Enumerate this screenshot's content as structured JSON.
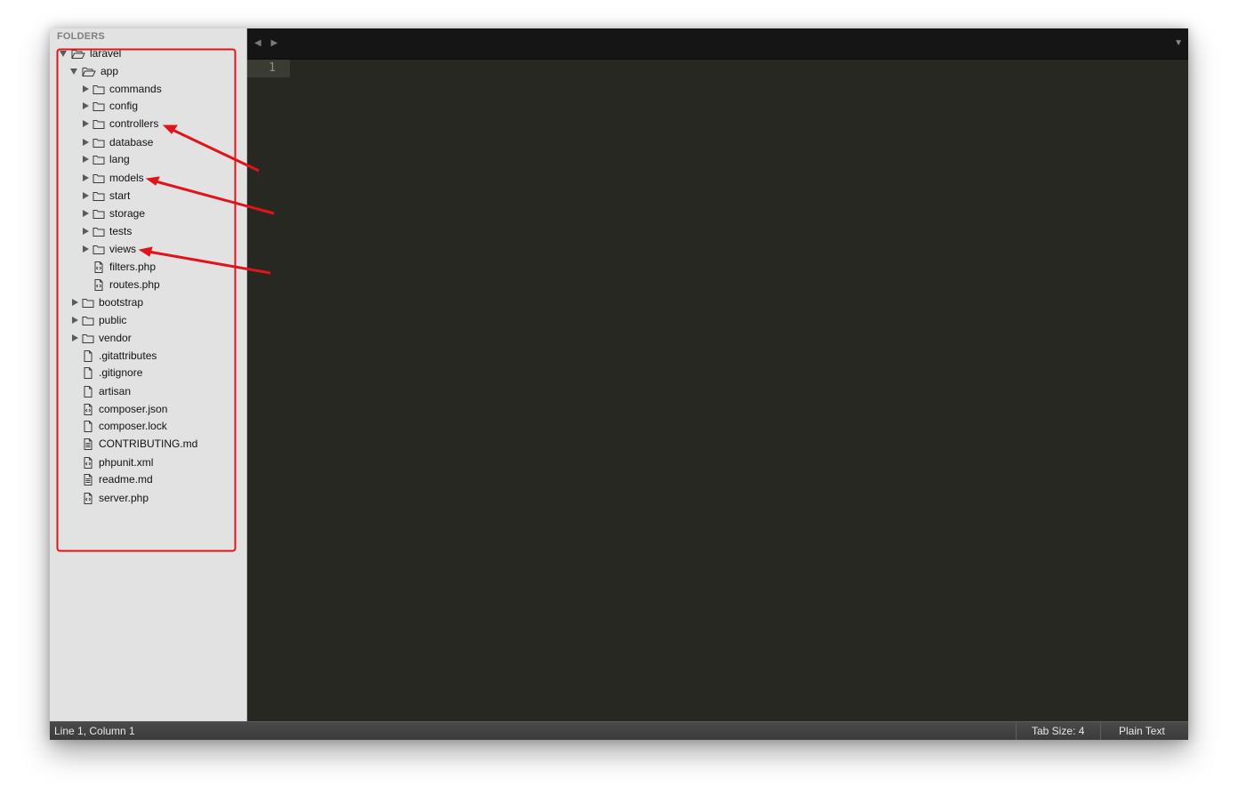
{
  "sidebar": {
    "header": "FOLDERS",
    "items": [
      {
        "label": "laravel",
        "kind": "folder-open",
        "depth": 0,
        "arrow": "down"
      },
      {
        "label": "app",
        "kind": "folder-open",
        "depth": 1,
        "arrow": "down"
      },
      {
        "label": "commands",
        "kind": "folder",
        "depth": 2,
        "arrow": "right"
      },
      {
        "label": "config",
        "kind": "folder",
        "depth": 2,
        "arrow": "right"
      },
      {
        "label": "controllers",
        "kind": "folder",
        "depth": 2,
        "arrow": "right"
      },
      {
        "label": "database",
        "kind": "folder",
        "depth": 2,
        "arrow": "right"
      },
      {
        "label": "lang",
        "kind": "folder",
        "depth": 2,
        "arrow": "right"
      },
      {
        "label": "models",
        "kind": "folder",
        "depth": 2,
        "arrow": "right"
      },
      {
        "label": "start",
        "kind": "folder",
        "depth": 2,
        "arrow": "right"
      },
      {
        "label": "storage",
        "kind": "folder",
        "depth": 2,
        "arrow": "right"
      },
      {
        "label": "tests",
        "kind": "folder",
        "depth": 2,
        "arrow": "right"
      },
      {
        "label": "views",
        "kind": "folder",
        "depth": 2,
        "arrow": "right"
      },
      {
        "label": "filters.php",
        "kind": "code-file",
        "depth": 2,
        "arrow": "none"
      },
      {
        "label": "routes.php",
        "kind": "code-file",
        "depth": 2,
        "arrow": "none"
      },
      {
        "label": "bootstrap",
        "kind": "folder",
        "depth": 1,
        "arrow": "right"
      },
      {
        "label": "public",
        "kind": "folder",
        "depth": 1,
        "arrow": "right"
      },
      {
        "label": "vendor",
        "kind": "folder",
        "depth": 1,
        "arrow": "right"
      },
      {
        "label": ".gitattributes",
        "kind": "file",
        "depth": 1,
        "arrow": "none"
      },
      {
        "label": ".gitignore",
        "kind": "file",
        "depth": 1,
        "arrow": "none"
      },
      {
        "label": "artisan",
        "kind": "file",
        "depth": 1,
        "arrow": "none"
      },
      {
        "label": "composer.json",
        "kind": "code-file",
        "depth": 1,
        "arrow": "none"
      },
      {
        "label": "composer.lock",
        "kind": "file",
        "depth": 1,
        "arrow": "none"
      },
      {
        "label": "CONTRIBUTING.md",
        "kind": "text-file",
        "depth": 1,
        "arrow": "none"
      },
      {
        "label": "phpunit.xml",
        "kind": "code-file",
        "depth": 1,
        "arrow": "none"
      },
      {
        "label": "readme.md",
        "kind": "text-file",
        "depth": 1,
        "arrow": "none"
      },
      {
        "label": "server.php",
        "kind": "code-file",
        "depth": 1,
        "arrow": "none"
      }
    ]
  },
  "editor": {
    "nav_arrows": "◀ ▶",
    "tab_menu": "▼",
    "line_number": "1"
  },
  "status": {
    "position": "Line 1, Column 1",
    "tab_size": "Tab Size: 4",
    "syntax": "Plain Text"
  },
  "colors": {
    "annotation": "#e0141b",
    "editor_bg": "#272822",
    "sidebar_bg": "#e2e2e2"
  }
}
